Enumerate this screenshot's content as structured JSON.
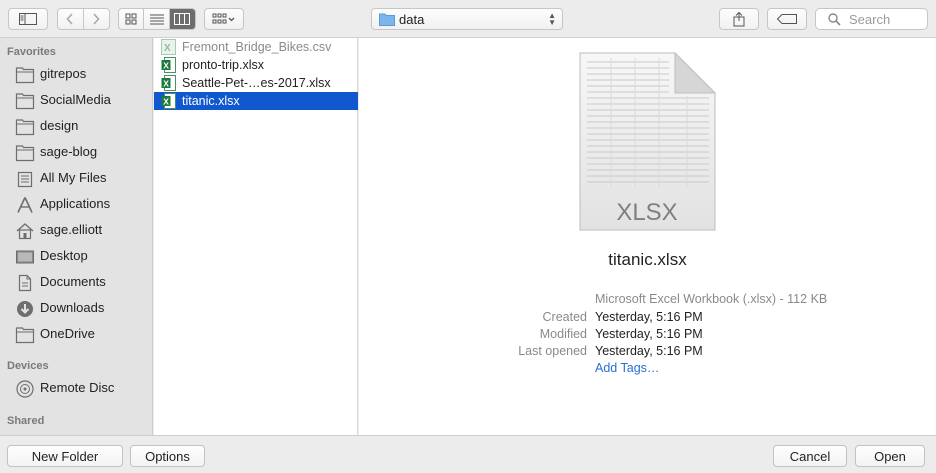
{
  "toolbar": {
    "path": {
      "folder": "data",
      "icon": "folder-icon"
    },
    "search": {
      "placeholder": "Search"
    },
    "view_mode": "columns"
  },
  "sidebar": {
    "favorites_label": "Favorites",
    "favorites": [
      {
        "label": "gitrepos",
        "icon": "folder-icon"
      },
      {
        "label": "SocialMedia",
        "icon": "folder-icon"
      },
      {
        "label": "design",
        "icon": "folder-icon"
      },
      {
        "label": "sage-blog",
        "icon": "folder-icon"
      },
      {
        "label": "All My Files",
        "icon": "all-files-icon"
      },
      {
        "label": "Applications",
        "icon": "applications-icon"
      },
      {
        "label": "sage.elliott",
        "icon": "home-icon"
      },
      {
        "label": "Desktop",
        "icon": "desktop-icon"
      },
      {
        "label": "Documents",
        "icon": "documents-icon"
      },
      {
        "label": "Downloads",
        "icon": "downloads-icon"
      },
      {
        "label": "OneDrive",
        "icon": "folder-icon"
      }
    ],
    "devices_label": "Devices",
    "devices": [
      {
        "label": "Remote Disc",
        "icon": "disc-icon"
      }
    ],
    "shared_label": "Shared"
  },
  "files": [
    {
      "name": "Fremont_Bridge_Bikes.csv",
      "type": "csv",
      "selected": false,
      "dimmed": true
    },
    {
      "name": "pronto-trip.xlsx",
      "type": "xlsx",
      "selected": false,
      "dimmed": false
    },
    {
      "name": "Seattle-Pet-…es-2017.xlsx",
      "type": "xlsx",
      "selected": false,
      "dimmed": false
    },
    {
      "name": "titanic.xlsx",
      "type": "xlsx",
      "selected": true,
      "dimmed": false
    }
  ],
  "preview": {
    "icon_label": "XLSX",
    "name": "titanic.xlsx",
    "kind": "Microsoft Excel Workbook (.xlsx) - 112 KB",
    "created_label": "Created",
    "created": "Yesterday, 5:16 PM",
    "modified_label": "Modified",
    "modified": "Yesterday, 5:16 PM",
    "last_opened_label": "Last opened",
    "last_opened": "Yesterday, 5:16 PM",
    "add_tags": "Add Tags…"
  },
  "buttons": {
    "new_folder": "New Folder",
    "options": "Options",
    "cancel": "Cancel",
    "open": "Open"
  },
  "colors": {
    "selection": "#1058d0",
    "link": "#2a6fd6",
    "folder": "#7ab6ea"
  }
}
